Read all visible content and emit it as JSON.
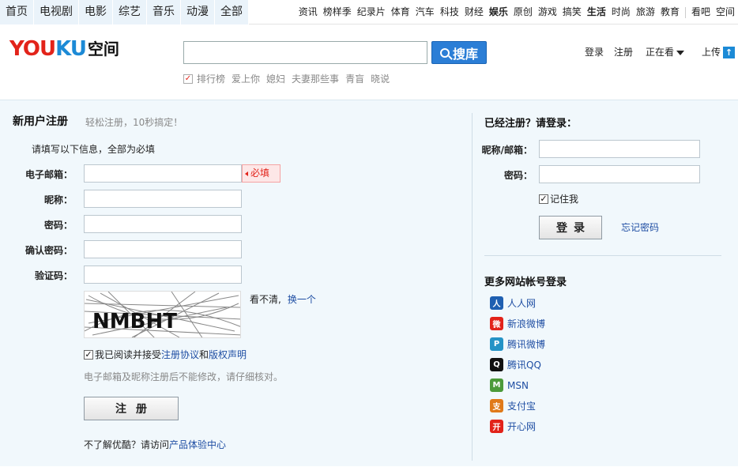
{
  "topnav": {
    "channels": [
      "首页",
      "电视剧",
      "电影",
      "综艺",
      "音乐",
      "动漫",
      "全部"
    ],
    "links": [
      "资讯",
      "榜样季",
      "纪录片",
      "体育",
      "汽车",
      "科技",
      "财经",
      "娱乐",
      "原创",
      "游戏",
      "搞笑",
      "生活",
      "时尚",
      "旅游",
      "教育"
    ],
    "bold_links": [
      "娱乐",
      "生活"
    ],
    "extra": [
      "看吧",
      "空间"
    ]
  },
  "header": {
    "logo_you": "YOU",
    "logo_ku": "KU",
    "logo_suffix": "空间",
    "search_value": "",
    "search_button": "搜库",
    "hot_keywords": [
      "排行榜",
      "爱上你",
      "媳妇",
      "夫妻那些事",
      "青盲",
      "晓说"
    ],
    "user_links": {
      "login": "登录",
      "register": "注册",
      "watching": "正在看",
      "upload": "上传"
    }
  },
  "register": {
    "title": "新用户注册",
    "subtitle": "轻松注册，10秒搞定！",
    "note": "请填写以下信息，全部为必填",
    "labels": {
      "email": "电子邮箱：",
      "nickname": "昵称：",
      "password": "密码：",
      "confirm": "确认密码：",
      "captcha": "验证码："
    },
    "required_tip": "必填",
    "captcha_text": "NMBHT",
    "captcha_note": "看不清,",
    "captcha_change": "换一个",
    "agree_text": "我已阅读并接受",
    "agree_link1": "注册协议",
    "agree_and": "和",
    "agree_link2": "版权声明",
    "warning": "电子邮箱及昵称注册后不能修改，请仔细核对。",
    "button": "注册",
    "visit_text": "不了解优酷？请访问",
    "visit_link": "产品体验中心"
  },
  "login": {
    "title": "已经注册？请登录：",
    "labels": {
      "account": "昵称/邮箱：",
      "password": "密码："
    },
    "remember": "记住我",
    "button": "登录",
    "forgot": "忘记密码",
    "more_title": "更多网站帐号登录",
    "sites": [
      {
        "name": "人人网",
        "icon": "renren-icon",
        "color": "#1f5fb1"
      },
      {
        "name": "新浪微博",
        "icon": "weibo-icon",
        "color": "#e2231a"
      },
      {
        "name": "腾讯微博",
        "icon": "tencent-weibo-icon",
        "color": "#2593c6"
      },
      {
        "name": "腾讯QQ",
        "icon": "qq-icon",
        "color": "#111111"
      },
      {
        "name": "MSN",
        "icon": "msn-icon",
        "color": "#4c9a3a"
      },
      {
        "name": "支付宝",
        "icon": "alipay-icon",
        "color": "#e07a1a"
      },
      {
        "name": "开心网",
        "icon": "kaixin-icon",
        "color": "#e2231a"
      }
    ]
  }
}
